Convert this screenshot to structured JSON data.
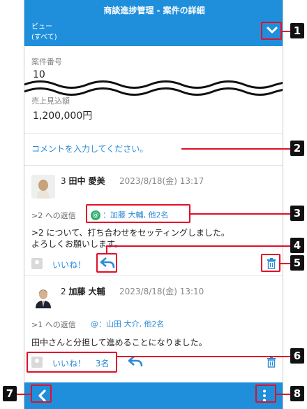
{
  "header": {
    "title": "商談進捗管理 - 案件の詳細",
    "view_label": "ビュー",
    "view_value": "(すべて)"
  },
  "fields": [
    {
      "label": "案件番号",
      "value": "10"
    },
    {
      "label": "売上見込額",
      "value": "1,200,000円"
    }
  ],
  "comment_input": {
    "placeholder": "コメントを入力してください。"
  },
  "comments": [
    {
      "number": "3",
      "author": "田中 愛美",
      "timestamp": "2023/8/18(金) 13:17",
      "reply_to": ">2 への返信",
      "mention": "加藤 大輔, 他2名",
      "body_line1": ">2 について、打ち合わせをセッティングしました。",
      "body_line2": "よろしくお願いします。",
      "like_label": "いいね！"
    },
    {
      "number": "2",
      "author": "加藤 大輔",
      "timestamp": "2023/8/18(金) 13:10",
      "reply_to": ">1 への返信",
      "mention": "@：山田 大介, 他2名",
      "body_line1": "田中さんと分担して進めることになりました。",
      "like_label": "いいね！",
      "like_count": "3名"
    }
  ],
  "mention_badge": "@",
  "mention_prefix": "：",
  "callout_numbers": [
    "1",
    "2",
    "3",
    "4",
    "5",
    "6",
    "7",
    "8"
  ],
  "colors": {
    "primary": "#1f8fdc",
    "link": "#2a8bd7",
    "callout": "#e0102a"
  }
}
